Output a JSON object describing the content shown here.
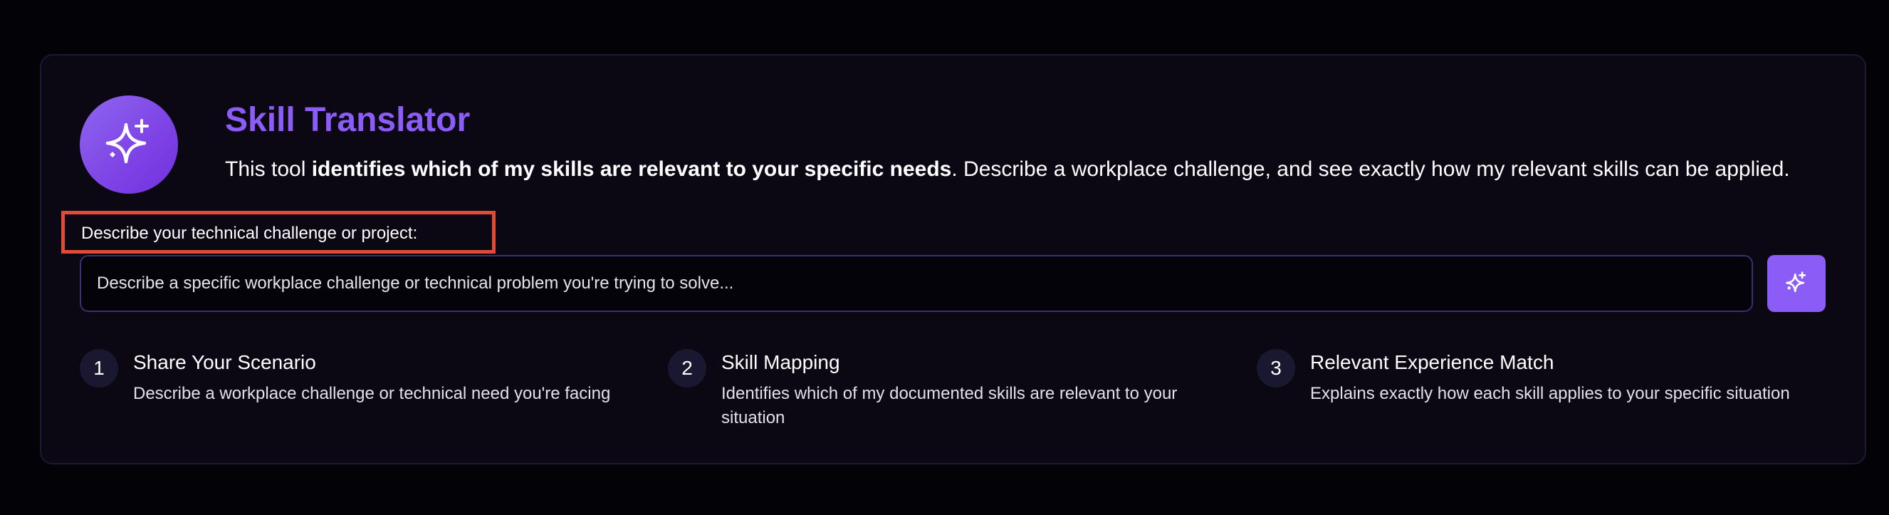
{
  "header": {
    "title": "Skill Translator",
    "description_pre": "This tool ",
    "description_bold": "identifies which of my skills are relevant to your specific needs",
    "description_post": ". Describe a workplace challenge, and see exactly how my relevant skills can be applied."
  },
  "form": {
    "label": "Describe your technical challenge or project:",
    "placeholder": "Describe a specific workplace challenge or technical problem you're trying to solve...",
    "value": "",
    "submit_icon": "sparkles-icon"
  },
  "logo_icon": "sparkles-icon",
  "steps": [
    {
      "number": "1",
      "title": "Share Your Scenario",
      "description": "Describe a workplace challenge or technical need you're facing"
    },
    {
      "number": "2",
      "title": "Skill Mapping",
      "description": "Identifies which of my documented skills are relevant to your situation"
    },
    {
      "number": "3",
      "title": "Relevant Experience Match",
      "description": "Explains exactly how each skill applies to your specific situation"
    }
  ],
  "colors": {
    "accent": "#8b5cf6",
    "background": "#030207",
    "card": "#0b0814",
    "highlight_box": "#e04a36"
  }
}
